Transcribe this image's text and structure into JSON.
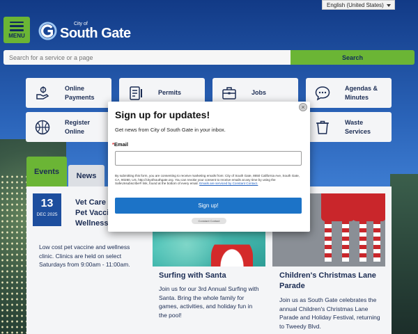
{
  "language": {
    "selected": "English (United States)"
  },
  "header": {
    "menu_label": "MENU",
    "logo_small": "City of",
    "logo_big": "South Gate"
  },
  "search": {
    "placeholder": "Search for a service or a page",
    "button": "Search"
  },
  "quick_links": [
    {
      "label": "Online Payments",
      "icon": "payment-hand-icon"
    },
    {
      "label": "Permits",
      "icon": "permit-clipboard-icon"
    },
    {
      "label": "Jobs",
      "icon": "briefcase-icon"
    },
    {
      "label": "Agendas & Minutes",
      "icon": "chat-bubble-icon"
    },
    {
      "label": "Register Online",
      "icon": "basketball-icon"
    },
    {
      "label": "Waste Services",
      "icon": "trash-can-icon"
    }
  ],
  "tabs": {
    "events": "Events",
    "news": "News"
  },
  "event": {
    "day": "13",
    "month_year": "DEC 2025",
    "title": "Vet Care Low Cost Pet Vaccine and Wellness Clinic",
    "description": "Low cost pet vaccine and wellness clinic. Clinics are held on select Saturdays from 9:00am - 11:00am."
  },
  "cards": [
    {
      "title": "Surfing with Santa",
      "description": "Join us for our 3rd Annual Surfing with Santa. Bring the whole family for games, activities, and holiday fun in the pool!"
    },
    {
      "title": "Children's Christmas Lane Parade",
      "description": "Join us as South Gate celebrates the annual Children's Christmas Lane Parade and Holiday Festival, returning to Tweedy Blvd."
    }
  ],
  "modal": {
    "title": "Sign up for updates!",
    "subtitle": "Get news from City of South Gate in your inbox.",
    "email_label": "Email",
    "required_mark": "*",
    "legal": "By submitting this form, you are consenting to receive marketing emails from: City of South Gate, 8650 California Ave, South Gate, CA, 90280, US, http://cityofsouthgate.org. You can revoke your consent to receive emails at any time by using the SafeUnsubscribe® link, found at the bottom of every email.",
    "legal_link": "Emails are serviced by Constant Contact.",
    "button": "Sign up!",
    "badge": "Constant Contact",
    "close": "×"
  },
  "colors": {
    "green": "#6bb535",
    "navy": "#1b2c53",
    "blue": "#1c73c7"
  }
}
